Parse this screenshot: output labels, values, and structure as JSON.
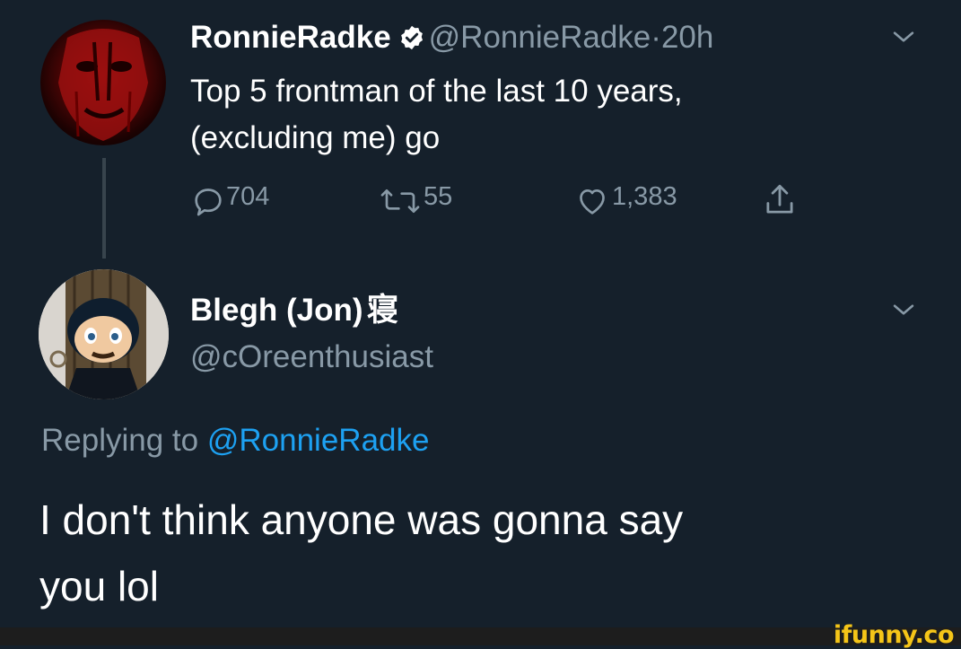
{
  "tweet": {
    "author_name": "RonnieRadke",
    "author_handle": "@RonnieRadke",
    "separator": "·",
    "time": "20h",
    "text_line1": "Top 5 frontman of the last 10 years,",
    "text_line2": "(excluding me) go",
    "reply_count": "704",
    "retweet_count": "55",
    "like_count": "1,383"
  },
  "reply": {
    "author_name": "Blegh (Jon)",
    "author_name_glyph": "寝",
    "author_handle": "@cOreenthusiast",
    "replying_prefix": "Replying to",
    "replying_mention": "@RonnieRadke",
    "text_line1": "I don't think anyone was gonna say",
    "text_line2": "you lol"
  },
  "watermark": "ifunny.co",
  "colors": {
    "background": "#15202b",
    "secondary_text": "#8899a6",
    "link": "#1da1f2",
    "watermark": "#f5c518"
  }
}
